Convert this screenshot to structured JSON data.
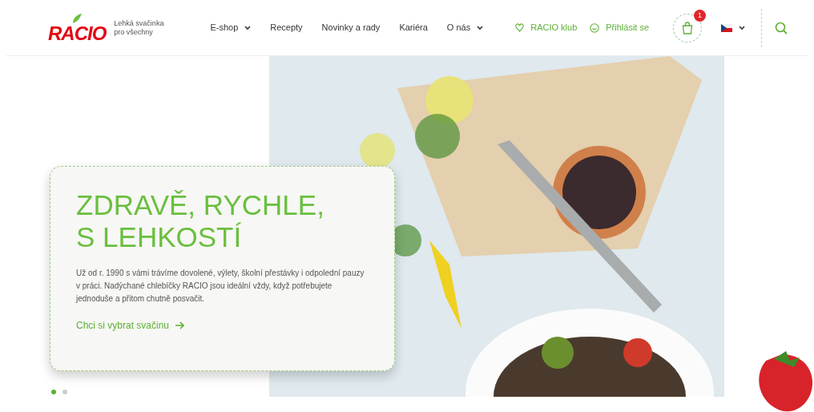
{
  "header": {
    "logo": "RACIO",
    "tagline_lines": [
      "Lehká svačinka",
      "pro všechny"
    ],
    "nav": [
      {
        "label": "E-shop",
        "dropdown": true
      },
      {
        "label": "Recepty",
        "dropdown": false
      },
      {
        "label": "Novinky a rady",
        "dropdown": false
      },
      {
        "label": "Kariéra",
        "dropdown": false
      },
      {
        "label": "O nás",
        "dropdown": true
      }
    ],
    "club_link": "RACIO klub",
    "login_link": "Přihlásit se",
    "cart_count": "1"
  },
  "hero": {
    "title_lines": [
      "ZDRAVĚ, RYCHLE,",
      "S LEHKOSTÍ"
    ],
    "text": "Už od r. 1990 s vámi trávíme dovolené, výlety, školní přestávky i odpolední pauzy v práci. Nadýchané chlebíčky RACIO jsou ideální vždy, když potřebujete jednoduše a přitom chutně posvačit.",
    "cta": "Chci si vybrat svačinu",
    "slides": [
      {
        "selected": true
      },
      {
        "selected": false
      }
    ]
  }
}
